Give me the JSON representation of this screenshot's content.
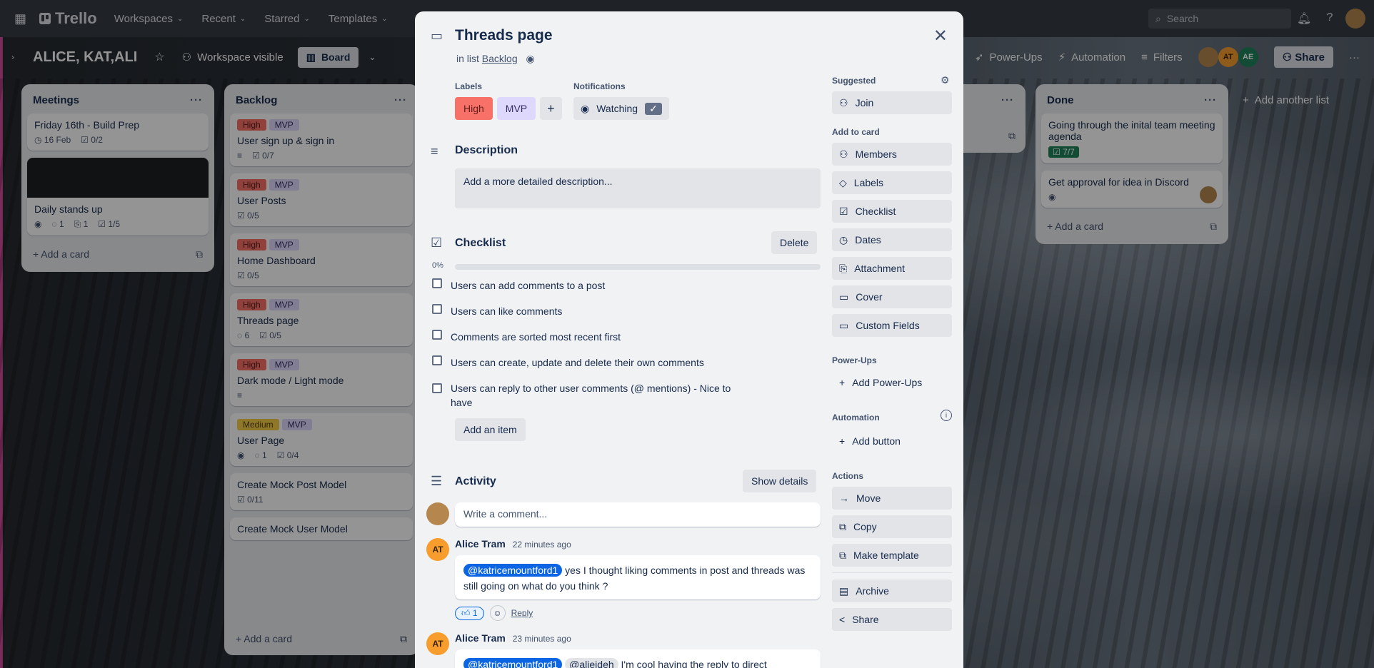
{
  "topnav": {
    "app": "Trello",
    "items": [
      "Workspaces",
      "Recent",
      "Starred",
      "Templates"
    ],
    "search_placeholder": "Search"
  },
  "board": {
    "name": "ALICE, KAT,ALI",
    "visibility": "Workspace visible",
    "view": "Board",
    "powerups": "Power-Ups",
    "automation": "Automation",
    "filters": "Filters",
    "share": "Share",
    "avatars": [
      {
        "initials": "",
        "color": "#b5874f"
      },
      {
        "initials": "AT",
        "color": "#f79d2d"
      },
      {
        "initials": "AE",
        "color": "#1f845a"
      }
    ]
  },
  "lists": [
    {
      "title": "Meetings",
      "cards": [
        {
          "title": "Friday 16th - Build Prep",
          "badges": [
            "16 Feb",
            "0/2"
          ]
        },
        {
          "title": "Daily stands up",
          "badges": [
            "1",
            "1",
            "1/5"
          ],
          "cover": true
        }
      ],
      "add": "Add a card"
    },
    {
      "title": "Backlog",
      "cards": [
        {
          "labels": [
            "High",
            "MVP"
          ],
          "title": "User sign up & sign in",
          "badges": [
            "0/7"
          ]
        },
        {
          "labels": [
            "High",
            "MVP"
          ],
          "title": "User Posts",
          "badges": [
            "0/5"
          ]
        },
        {
          "labels": [
            "High",
            "MVP"
          ],
          "title": "Home Dashboard",
          "badges": [
            "0/5"
          ]
        },
        {
          "labels": [
            "High",
            "MVP"
          ],
          "title": "Threads page",
          "badges": [
            "6",
            "0/5"
          ]
        },
        {
          "labels": [
            "High",
            "MVP"
          ],
          "title": "Dark mode / Light mode",
          "badges": []
        },
        {
          "labels": [
            "Medium",
            "MVP"
          ],
          "title": "User Page",
          "badges": [
            "1",
            "0/4"
          ]
        },
        {
          "labels": [],
          "title": "Create Mock Post Model",
          "badges": [
            "0/11"
          ]
        },
        {
          "labels": [],
          "title": "Create Mock User Model",
          "badges": []
        }
      ],
      "add": "Add a card"
    },
    {
      "title": "Done",
      "cards": [
        {
          "title": "Going through the inital team meeting agenda",
          "badges": [
            "7/7"
          ]
        },
        {
          "title": "Get approval for idea in Discord",
          "badges": []
        }
      ],
      "add": "Add a card"
    }
  ],
  "add_list": "Add another list",
  "modal": {
    "title": "Threads page",
    "in_list_prefix": "in list",
    "list_name": "Backlog",
    "labels_heading": "Labels",
    "labels": [
      "High",
      "MVP"
    ],
    "notifications_heading": "Notifications",
    "watching": "Watching",
    "description_heading": "Description",
    "description_placeholder": "Add a more detailed description...",
    "checklist_heading": "Checklist",
    "delete": "Delete",
    "progress": "0%",
    "progress_value": 0,
    "items": [
      "Users can add comments to a post",
      "Users can like comments",
      "Comments are sorted most recent first",
      "Users can create, update and delete their own comments",
      "Users can reply to other user comments (@ mentions) - Nice to have"
    ],
    "add_item": "Add an item",
    "activity_heading": "Activity",
    "show_details": "Show details",
    "comment_placeholder": "Write a comment...",
    "comments": [
      {
        "author": "Alice Tram",
        "time": "22 minutes ago",
        "mention": "@katricemountford1",
        "text": "yes I thought liking comments in post and threads was still going on what do you think ?",
        "reaction": "1",
        "reply": "Reply"
      },
      {
        "author": "Alice Tram",
        "time": "23 minutes ago",
        "mention": "@katricemountford1",
        "mention2": "@alieideh",
        "text": "I'm cool having the reply to direct"
      }
    ],
    "sidebar": {
      "suggested": "Suggested",
      "join": "Join",
      "add_to_card": "Add to card",
      "add_items": [
        "Members",
        "Labels",
        "Checklist",
        "Dates",
        "Attachment",
        "Cover",
        "Custom Fields"
      ],
      "powerups": "Power-Ups",
      "add_powerups": "Add Power-Ups",
      "automation": "Automation",
      "add_button": "Add button",
      "actions": "Actions",
      "action_items": [
        "Move",
        "Copy",
        "Make template",
        "Archive",
        "Share"
      ]
    }
  },
  "colors": {
    "high": "#f87168",
    "mvp": "#dfd8fd",
    "medium": "#f5cd47",
    "accent": "#0c66e4"
  }
}
